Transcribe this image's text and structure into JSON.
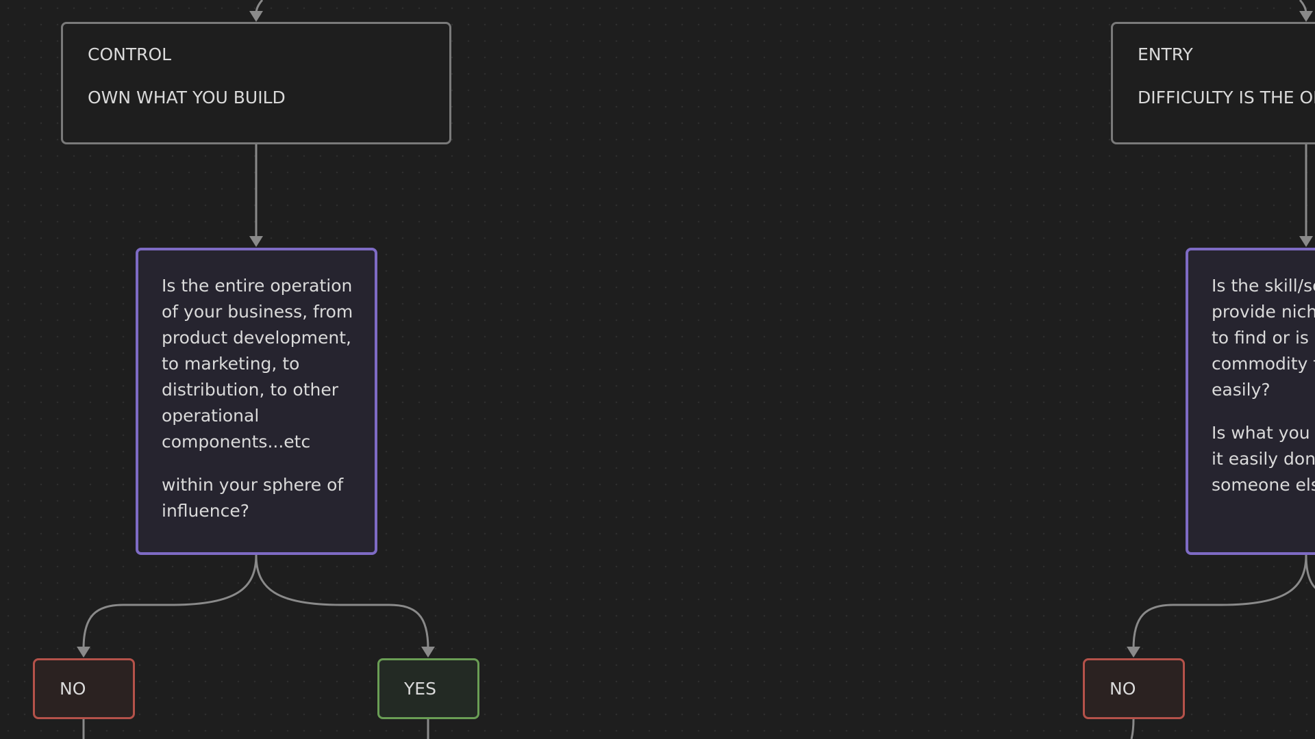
{
  "colors": {
    "background": "#1e1e1e",
    "grid_dot": "#2e2e2e",
    "edge": "#8a8a8a",
    "gray_border": "#7a7a7a",
    "purple_border": "#7e6bc4",
    "purple_fill": "#26242f",
    "red_border": "#b5524a",
    "red_fill": "#2b2221",
    "green_border": "#6a9e55",
    "green_fill": "#232a24",
    "text": "#dadada"
  },
  "nodes": {
    "control": {
      "title": "CONTROL",
      "subtitle": "OWN WHAT YOU BUILD"
    },
    "entry": {
      "title": "ENTRY",
      "subtitle": "DIFFICULTY IS THE OPP"
    },
    "question_control": {
      "lines": [
        "Is the entire operation",
        "of your business, from",
        "product development,",
        "to marketing, to",
        "distribution, to other",
        "operational",
        "components...etc"
      ],
      "lines2": [
        "within your sphere of",
        "influence?"
      ]
    },
    "question_entry": {
      "lines": [
        "Is the skill/ser",
        "provide niche",
        "to find or is it",
        "commodity fo",
        "easily?"
      ],
      "lines2": [
        "Is what you d",
        "it easily done",
        "someone else"
      ]
    },
    "no_1": {
      "label": "NO"
    },
    "yes_1": {
      "label": "YES"
    },
    "no_2": {
      "label": "NO"
    }
  }
}
